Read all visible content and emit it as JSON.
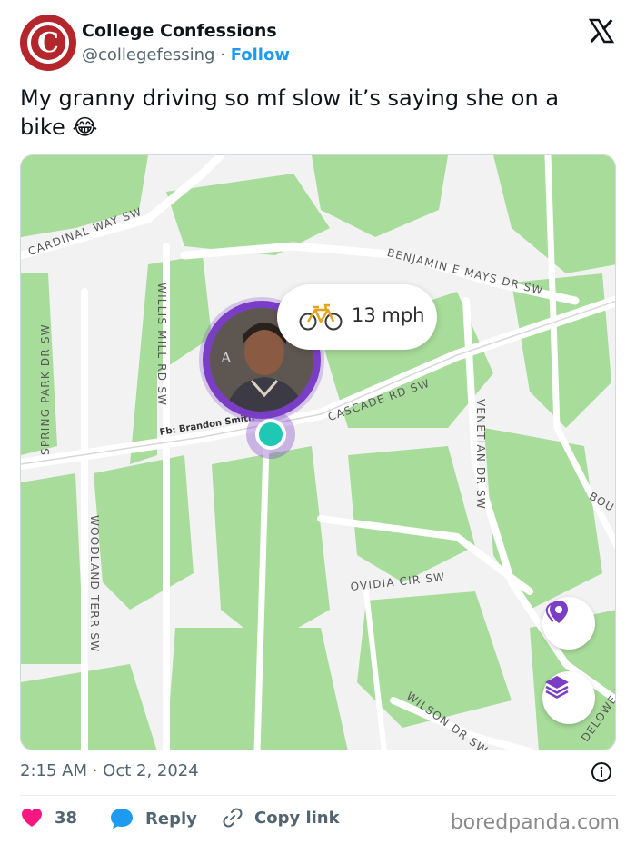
{
  "tweet": {
    "account_name": "College Confessions",
    "handle": "@collegefessing",
    "separator": "·",
    "follow_label": "Follow",
    "avatar_letter": "C",
    "text_line1": "My granny driving so mf slow it’s saying she on a",
    "text_line2": "bike 😂",
    "timestamp": "2:15 AM · Oct 2, 2024"
  },
  "map": {
    "speed": "13 mph",
    "watermark": "Fb: Brandon Smith",
    "person_badge": "A",
    "roads": {
      "cardinal": "CARDINAL WAY SW",
      "benjamin": "BENJAMIN E MAYS DR SW",
      "willis": "WILLIS MILL RD SW",
      "spring": "SPRING PARK DR SW",
      "cascade": "CASCADE RD SW",
      "venetian": "VENETIAN DR SW",
      "woodland": "WOODLAND TERR SW",
      "ovidia": "OVIDIA CIR SW",
      "wilson": "WILSON DR SW",
      "delowe": "DELOWE D",
      "bou": "BOU"
    }
  },
  "actions": {
    "likes": "38",
    "reply_label": "Reply",
    "copy_label": "Copy link"
  },
  "source": "boredpanda.com",
  "colors": {
    "brand_red": "#b3262c",
    "link_blue": "#1d9bf0",
    "map_green": "#a8dc9a",
    "location_purple": "#7a3ec6"
  },
  "icons": [
    "x-logo-icon",
    "heart-icon",
    "reply-bubble-icon",
    "link-icon",
    "info-icon",
    "bicycle-icon",
    "location-pin-icon",
    "layers-icon"
  ]
}
